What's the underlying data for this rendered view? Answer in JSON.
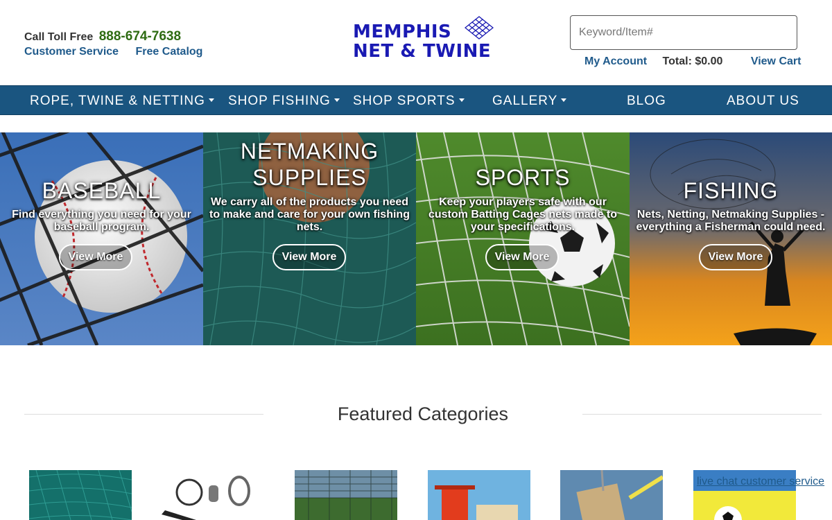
{
  "header": {
    "call_label": "Call Toll Free",
    "phone": "888-674-7638",
    "customer_service": "Customer Service",
    "free_catalog": "Free Catalog",
    "logo_line1": "MEMPHIS",
    "logo_line2": "NET & TWINE",
    "search_placeholder": "Keyword/Item#",
    "my_account": "My Account",
    "total": "Total: $0.00",
    "view_cart": "View Cart"
  },
  "nav": {
    "items": [
      {
        "label": "ROPE, TWINE & NETTING",
        "dropdown": true
      },
      {
        "label": "SHOP FISHING",
        "dropdown": true
      },
      {
        "label": "SHOP SPORTS",
        "dropdown": true
      },
      {
        "label": "GALLERY",
        "dropdown": true
      },
      {
        "label": "BLOG",
        "dropdown": false
      },
      {
        "label": "ABOUT US",
        "dropdown": false
      }
    ]
  },
  "hero": {
    "panels": [
      {
        "title": "BASEBALL",
        "description": "Find everything you need for your baseball program.",
        "button": "View More"
      },
      {
        "title": "NETMAKING SUPPLIES",
        "description": "We carry all of the products you need to make and care for your own fishing nets.",
        "button": "View More"
      },
      {
        "title": "SPORTS",
        "description": "Keep your players safe with our custom Batting Cages nets made to your specifications.",
        "button": "View More"
      },
      {
        "title": "FISHING",
        "description": "Nets, Netting, Netmaking Supplies - everything a Fisherman could need.",
        "button": "View More"
      }
    ]
  },
  "featured": {
    "title": "Featured Categories"
  },
  "live_chat": "live chat customer service",
  "colors": {
    "nav_bg": "#1a5580",
    "link": "#1f5a8b",
    "phone": "#2e6b12",
    "logo": "#1a1ab3"
  }
}
